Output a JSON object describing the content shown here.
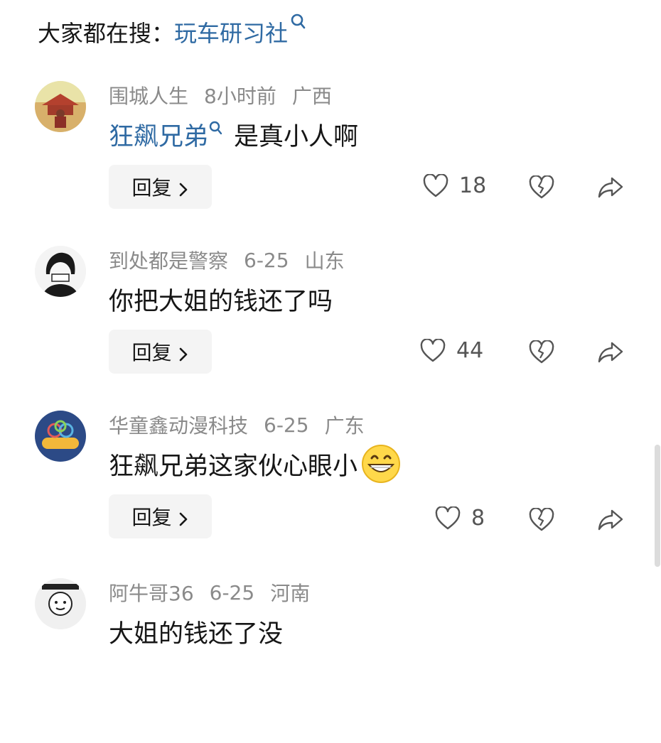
{
  "search": {
    "prefix": "大家都在搜：",
    "term": "玩车研习社"
  },
  "comments": [
    {
      "username": "围城人生",
      "time": "8小时前",
      "location": "广西",
      "mention": "狂飙兄弟",
      "text": "是真小人啊",
      "reply_label": "回复",
      "likes": "18"
    },
    {
      "username": "到处都是警察",
      "time": "6-25",
      "location": "山东",
      "mention": "",
      "text": "你把大姐的钱还了吗",
      "reply_label": "回复",
      "likes": "44"
    },
    {
      "username": "华童鑫动漫科技",
      "time": "6-25",
      "location": "广东",
      "mention": "",
      "text": "狂飙兄弟这家伙心眼小",
      "emoji": "grinning-face-emoji",
      "reply_label": "回复",
      "likes": "8"
    },
    {
      "username": "阿牛哥36",
      "time": "6-25",
      "location": "河南",
      "mention": "",
      "text": "大姐的钱还了没",
      "reply_label": "回复",
      "likes": ""
    }
  ],
  "icons": {
    "search": "search-icon",
    "like": "heart-icon",
    "dislike": "broken-heart-icon",
    "share": "share-arrow-icon",
    "chevron": "chevron-right-icon"
  },
  "colors": {
    "link": "#2f6aa3",
    "meta": "#8a8a8a",
    "text": "#161616",
    "button_bg": "#f4f4f4"
  }
}
